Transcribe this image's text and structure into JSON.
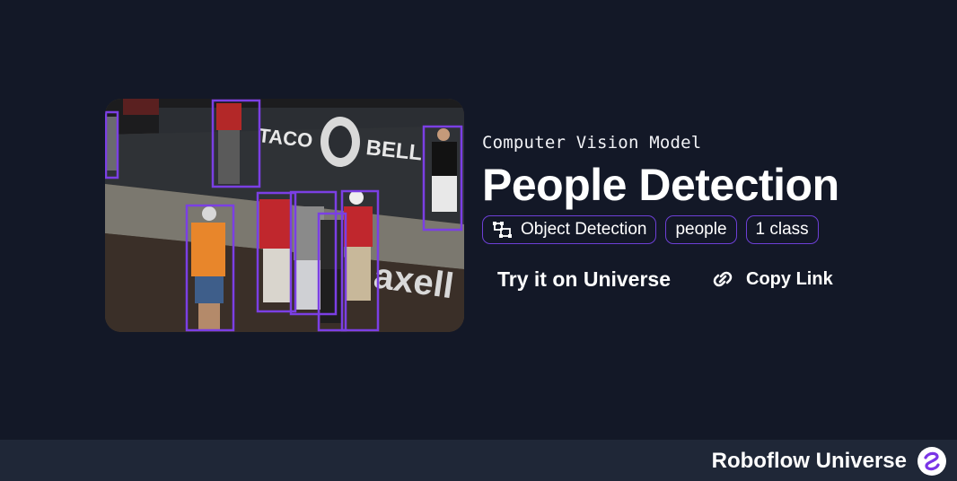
{
  "card": {
    "subtitle": "Computer Vision Model",
    "title": "People Detection",
    "tags": [
      {
        "label": "Object Detection",
        "icon": "object-detection-icon"
      },
      {
        "label": "people"
      },
      {
        "label": "1 class"
      }
    ],
    "try_label": "Try it on Universe",
    "copy_label": "Copy Link",
    "copy_icon": "link-icon"
  },
  "thumbnail": {
    "banner_text_1": "TACO",
    "banner_text_2": "BELL",
    "banner_text_3": "axell",
    "box_color": "#7b3fe4"
  },
  "footer": {
    "brand": "Roboflow Universe",
    "logo_icon": "roboflow-logo-icon"
  },
  "colors": {
    "background": "#131827",
    "footer": "#1f2737",
    "accent": "#6d3fd6"
  }
}
